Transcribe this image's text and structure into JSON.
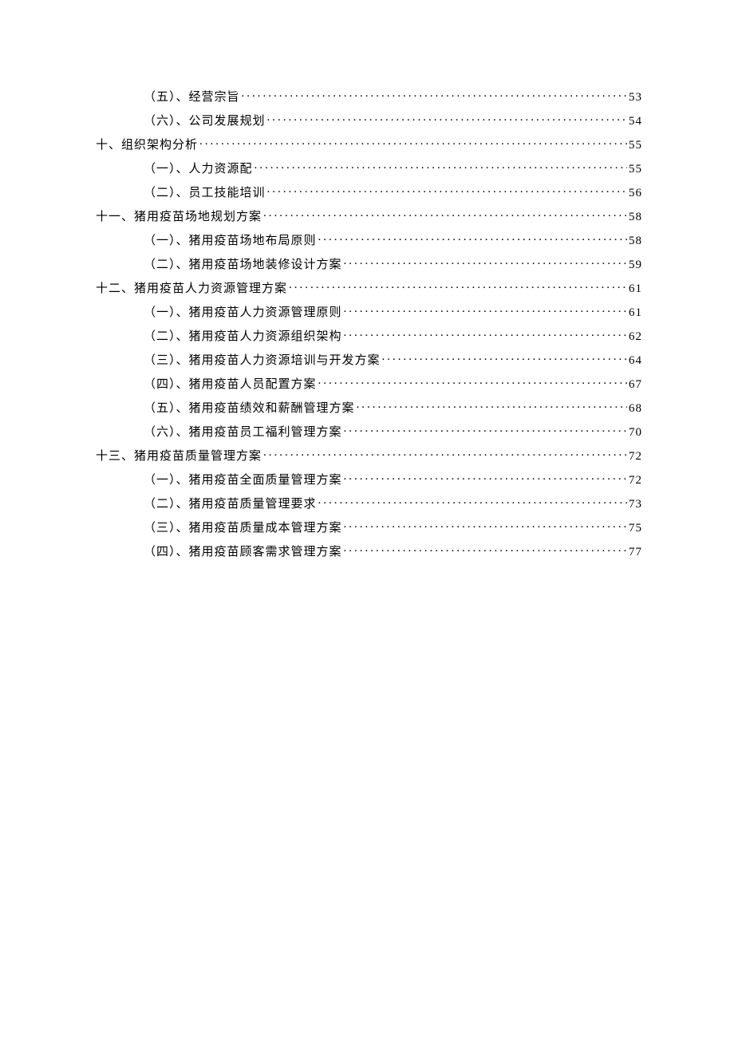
{
  "toc": [
    {
      "level": 2,
      "label": "（五）、经营宗旨",
      "page": "53"
    },
    {
      "level": 2,
      "label": "（六）、公司发展规划",
      "page": "54"
    },
    {
      "level": 1,
      "label": "十、组织架构分析",
      "page": "55"
    },
    {
      "level": 2,
      "label": "（一）、人力资源配",
      "page": "55"
    },
    {
      "level": 2,
      "label": "（二）、员工技能培训",
      "page": "56"
    },
    {
      "level": 1,
      "label": "十一、猪用疫苗场地规划方案",
      "page": "58"
    },
    {
      "level": 2,
      "label": "（一）、猪用疫苗场地布局原则",
      "page": "58"
    },
    {
      "level": 2,
      "label": "（二）、猪用疫苗场地装修设计方案",
      "page": "59"
    },
    {
      "level": 1,
      "label": "十二、猪用疫苗人力资源管理方案",
      "page": "61"
    },
    {
      "level": 2,
      "label": "（一）、猪用疫苗人力资源管理原则",
      "page": "61"
    },
    {
      "level": 2,
      "label": "（二）、猪用疫苗人力资源组织架构",
      "page": "62"
    },
    {
      "level": 2,
      "label": "（三）、猪用疫苗人力资源培训与开发方案",
      "page": "64"
    },
    {
      "level": 2,
      "label": "（四）、猪用疫苗人员配置方案",
      "page": "67"
    },
    {
      "level": 2,
      "label": "（五）、猪用疫苗绩效和薪酬管理方案",
      "page": "68"
    },
    {
      "level": 2,
      "label": "（六）、猪用疫苗员工福利管理方案",
      "page": "70"
    },
    {
      "level": 1,
      "label": "十三、猪用疫苗质量管理方案",
      "page": "72"
    },
    {
      "level": 2,
      "label": "（一）、猪用疫苗全面质量管理方案",
      "page": "72"
    },
    {
      "level": 2,
      "label": "（二）、猪用疫苗质量管理要求",
      "page": "73"
    },
    {
      "level": 2,
      "label": "（三）、猪用疫苗质量成本管理方案",
      "page": "75"
    },
    {
      "level": 2,
      "label": "（四）、猪用疫苗顾客需求管理方案",
      "page": "77"
    }
  ]
}
